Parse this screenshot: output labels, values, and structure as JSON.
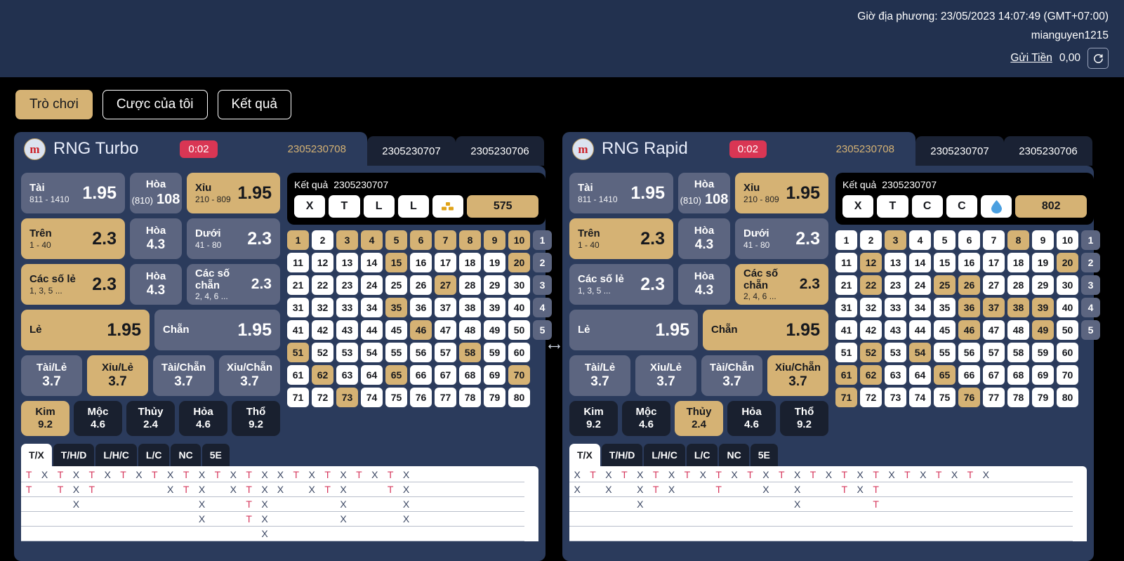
{
  "topbar": {
    "time_label": "Giờ địa phương: 23/05/2023 14:07:49 (GMT+07:00)",
    "username": "mianguyen1215",
    "deposit_label": "Gửi Tiền",
    "balance": "0,00",
    "refresh_icon": "refresh-icon",
    "background": "#22314f"
  },
  "nav": {
    "items": [
      {
        "label": "Trò chơi",
        "active": true
      },
      {
        "label": "Cược của tôi",
        "active": false
      },
      {
        "label": "Kết quả",
        "active": false
      }
    ]
  },
  "colors": {
    "gold": "#d5b274",
    "panel": "#2b3b5c",
    "dark": "#19202f",
    "slate": "#5c6580",
    "red": "#d93654",
    "road_t": "#d6395e",
    "road_x": "#3b4763"
  },
  "divider_icon": "horizontal-resize-icon",
  "panels": [
    {
      "id": "rng-turbo",
      "logo_letter": "m",
      "title": "RNG Turbo",
      "timer": "0:02",
      "round_tabs": [
        {
          "id": "2305230708",
          "active": true
        },
        {
          "id": "2305230707",
          "active": false
        },
        {
          "id": "2305230706",
          "active": false
        }
      ],
      "odds": {
        "row1": [
          {
            "name": "tai",
            "label": "Tài",
            "sub": "811 - 1410",
            "odd": "1.95",
            "gold": false
          },
          {
            "name": "hoa-810",
            "label": "Hòa",
            "sub": "(810)",
            "odd": "108",
            "gold": false,
            "style": "hoa108"
          },
          {
            "name": "xiu",
            "label": "Xỉu",
            "sub": "210 - 809",
            "odd": "1.95",
            "gold": true
          }
        ],
        "row2": [
          {
            "name": "tren",
            "label": "Trên",
            "sub": "1 - 40",
            "odd": "2.3",
            "gold": true
          },
          {
            "name": "hoa-mid",
            "label": "Hòa",
            "sub": "",
            "odd": "4.3",
            "gold": false,
            "style": "center"
          },
          {
            "name": "duoi",
            "label": "Dưới",
            "sub": "41 - 80",
            "odd": "2.3",
            "gold": false
          }
        ],
        "row3": [
          {
            "name": "cac-so-le",
            "label": "Các số lẻ",
            "sub": "1, 3, 5 ...",
            "odd": "2.3",
            "gold": true
          },
          {
            "name": "hoa-oddeven",
            "label": "Hòa",
            "sub": "",
            "odd": "4.3",
            "gold": false,
            "style": "center"
          },
          {
            "name": "cac-so-chan",
            "label": "Các số chẵn",
            "sub": "2, 4, 6 ...",
            "odd": "2.3",
            "gold": false
          }
        ],
        "row4": [
          {
            "name": "le",
            "label": "Lẻ",
            "sub": "",
            "odd": "1.95",
            "gold": true
          },
          {
            "name": "chan",
            "label": "Chẵn",
            "sub": "",
            "odd": "1.95",
            "gold": false
          }
        ],
        "row5": [
          {
            "name": "tai-le",
            "label": "Tài/Lẻ",
            "odd": "3.7",
            "gold": false
          },
          {
            "name": "xiu-le",
            "label": "Xỉu/Lẻ",
            "odd": "3.7",
            "gold": true
          },
          {
            "name": "tai-chan",
            "label": "Tài/Chẵn",
            "odd": "3.7",
            "gold": false
          },
          {
            "name": "xiu-chan",
            "label": "Xỉu/Chẵn",
            "odd": "3.7",
            "gold": false
          }
        ],
        "elements": [
          {
            "name": "kim",
            "label": "Kim",
            "odd": "9.2",
            "gold": true
          },
          {
            "name": "moc",
            "label": "Mộc",
            "odd": "4.6",
            "gold": false
          },
          {
            "name": "thuy",
            "label": "Thủy",
            "odd": "2.4",
            "gold": false
          },
          {
            "name": "hoa-element",
            "label": "Hỏa",
            "odd": "4.6",
            "gold": false
          },
          {
            "name": "tho",
            "label": "Thổ",
            "odd": "9.2",
            "gold": false
          }
        ]
      },
      "result": {
        "title": "Kết quả",
        "round_id": "2305230707",
        "chips": [
          "X",
          "T",
          "L",
          "L"
        ],
        "element_icon": "gold-bars-icon",
        "sum": "575"
      },
      "number_grid": {
        "rows": 8,
        "cols": 10,
        "highlighted": [
          1,
          3,
          4,
          5,
          6,
          7,
          8,
          9,
          10,
          15,
          20,
          27,
          35,
          46,
          51,
          58,
          62,
          65,
          70,
          73
        ],
        "row_marks": [
          "1",
          "2",
          "3",
          "4",
          "5",
          "",
          "",
          ""
        ]
      },
      "road_tabs": [
        {
          "label": "T/X",
          "active": true
        },
        {
          "label": "T/H/D",
          "active": false
        },
        {
          "label": "L/H/C",
          "active": false
        },
        {
          "label": "L/C",
          "active": false
        },
        {
          "label": "NC",
          "active": false
        },
        {
          "label": "5E",
          "active": false
        }
      ],
      "road_columns": [
        [
          "T",
          "T"
        ],
        [
          "X"
        ],
        [
          "T",
          "T"
        ],
        [
          "X",
          "X",
          "X"
        ],
        [
          "T",
          "T"
        ],
        [
          "X"
        ],
        [
          "T"
        ],
        [
          "X"
        ],
        [
          "T"
        ],
        [
          "X",
          "X"
        ],
        [
          "T",
          "T"
        ],
        [
          "X",
          "X",
          "X",
          "X"
        ],
        [
          "T"
        ],
        [
          "X",
          "X"
        ],
        [
          "T",
          "T",
          "T",
          "T"
        ],
        [
          "X",
          "X",
          "X",
          "X",
          "X"
        ],
        [
          "X",
          "X"
        ],
        [
          "T"
        ],
        [
          "X",
          "X"
        ],
        [
          "T",
          "T"
        ],
        [
          "X",
          "X",
          "X",
          "X"
        ],
        [
          "T"
        ],
        [
          "X"
        ],
        [
          "T",
          "T"
        ],
        [
          "X",
          "X",
          "X",
          "X"
        ]
      ],
      "road_last_marker": "□"
    },
    {
      "id": "rng-rapid",
      "logo_letter": "m",
      "title": "RNG Rapid",
      "timer": "0:02",
      "round_tabs": [
        {
          "id": "2305230708",
          "active": true
        },
        {
          "id": "2305230707",
          "active": false
        },
        {
          "id": "2305230706",
          "active": false
        }
      ],
      "odds": {
        "row1": [
          {
            "name": "tai",
            "label": "Tài",
            "sub": "811 - 1410",
            "odd": "1.95",
            "gold": false
          },
          {
            "name": "hoa-810",
            "label": "Hòa",
            "sub": "(810)",
            "odd": "108",
            "gold": false,
            "style": "hoa108"
          },
          {
            "name": "xiu",
            "label": "Xỉu",
            "sub": "210 - 809",
            "odd": "1.95",
            "gold": true
          }
        ],
        "row2": [
          {
            "name": "tren",
            "label": "Trên",
            "sub": "1 - 40",
            "odd": "2.3",
            "gold": true
          },
          {
            "name": "hoa-mid",
            "label": "Hòa",
            "sub": "",
            "odd": "4.3",
            "gold": false,
            "style": "center"
          },
          {
            "name": "duoi",
            "label": "Dưới",
            "sub": "41 - 80",
            "odd": "2.3",
            "gold": false
          }
        ],
        "row3": [
          {
            "name": "cac-so-le",
            "label": "Các số lẻ",
            "sub": "1, 3, 5 ...",
            "odd": "2.3",
            "gold": false
          },
          {
            "name": "hoa-oddeven",
            "label": "Hòa",
            "sub": "",
            "odd": "4.3",
            "gold": false,
            "style": "center"
          },
          {
            "name": "cac-so-chan",
            "label": "Các số chẵn",
            "sub": "2, 4, 6 ...",
            "odd": "2.3",
            "gold": true
          }
        ],
        "row4": [
          {
            "name": "le",
            "label": "Lẻ",
            "sub": "",
            "odd": "1.95",
            "gold": false
          },
          {
            "name": "chan",
            "label": "Chẵn",
            "sub": "",
            "odd": "1.95",
            "gold": true
          }
        ],
        "row5": [
          {
            "name": "tai-le",
            "label": "Tài/Lẻ",
            "odd": "3.7",
            "gold": false
          },
          {
            "name": "xiu-le",
            "label": "Xỉu/Lẻ",
            "odd": "3.7",
            "gold": false
          },
          {
            "name": "tai-chan",
            "label": "Tài/Chẵn",
            "odd": "3.7",
            "gold": false
          },
          {
            "name": "xiu-chan",
            "label": "Xỉu/Chẵn",
            "odd": "3.7",
            "gold": true
          }
        ],
        "elements": [
          {
            "name": "kim",
            "label": "Kim",
            "odd": "9.2",
            "gold": false
          },
          {
            "name": "moc",
            "label": "Mộc",
            "odd": "4.6",
            "gold": false
          },
          {
            "name": "thuy",
            "label": "Thủy",
            "odd": "2.4",
            "gold": true
          },
          {
            "name": "hoa-element",
            "label": "Hỏa",
            "odd": "4.6",
            "gold": false
          },
          {
            "name": "tho",
            "label": "Thổ",
            "odd": "9.2",
            "gold": false
          }
        ]
      },
      "result": {
        "title": "Kết quả",
        "round_id": "2305230707",
        "chips": [
          "X",
          "T",
          "C",
          "C"
        ],
        "element_icon": "water-drop-icon",
        "sum": "802"
      },
      "number_grid": {
        "rows": 8,
        "cols": 10,
        "highlighted": [
          3,
          8,
          12,
          20,
          22,
          25,
          26,
          36,
          37,
          38,
          39,
          46,
          49,
          52,
          54,
          61,
          62,
          65,
          71,
          76
        ],
        "row_marks": [
          "1",
          "2",
          "3",
          "4",
          "5",
          "",
          "",
          ""
        ]
      },
      "road_tabs": [
        {
          "label": "T/X",
          "active": true
        },
        {
          "label": "T/H/D",
          "active": false
        },
        {
          "label": "L/H/C",
          "active": false
        },
        {
          "label": "L/C",
          "active": false
        },
        {
          "label": "NC",
          "active": false
        },
        {
          "label": "5E",
          "active": false
        }
      ],
      "road_columns": [
        [
          "X",
          "X"
        ],
        [
          "T"
        ],
        [
          "X",
          "X"
        ],
        [
          "T"
        ],
        [
          "X",
          "X",
          "X"
        ],
        [
          "T",
          "T"
        ],
        [
          "X",
          "X"
        ],
        [
          "T"
        ],
        [
          "X"
        ],
        [
          "T",
          "T"
        ],
        [
          "X"
        ],
        [
          "T"
        ],
        [
          "X",
          "X"
        ],
        [
          "T"
        ],
        [
          "X",
          "X",
          "X"
        ],
        [
          "T"
        ],
        [
          "X"
        ],
        [
          "T",
          "T"
        ],
        [
          "X",
          "X"
        ],
        [
          "T",
          "T",
          "T"
        ],
        [
          "X"
        ],
        [
          "T"
        ],
        [
          "X"
        ],
        [
          "T"
        ],
        [
          "X"
        ],
        [
          "T"
        ],
        [
          "X"
        ]
      ],
      "road_last_marker": "□"
    }
  ]
}
